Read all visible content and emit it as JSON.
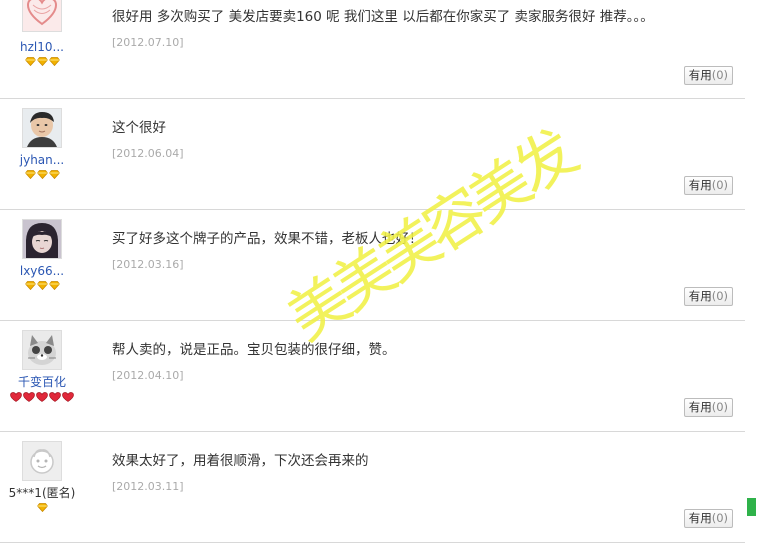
{
  "reviews": [
    {
      "username": "hzl10...",
      "rank_icon": "gold-diamond-icon",
      "rank_count": 3,
      "comment": "很好用 多次购买了 美发店要卖160 呢 我们这里 以后都在你家买了 卖家服务很好 推荐。。。",
      "date": "[2012.07.10]",
      "useful_label": "有用",
      "useful_count": "(0)",
      "avatar_icon": "heart-avatar-icon"
    },
    {
      "username": "jyhan...",
      "rank_icon": "gold-diamond-icon",
      "rank_count": 3,
      "comment": "这个很好",
      "date": "[2012.06.04]",
      "useful_label": "有用",
      "useful_count": "(0)",
      "avatar_icon": "person-photo-avatar-icon"
    },
    {
      "username": "lxy66...",
      "rank_icon": "gold-diamond-icon",
      "rank_count": 3,
      "comment": "买了好多这个牌子的产品，效果不错，老板人也好！",
      "date": "[2012.03.16]",
      "useful_label": "有用",
      "useful_count": "(0)",
      "avatar_icon": "portrait-avatar-icon"
    },
    {
      "username": "千变百化",
      "rank_icon": "red-heart-icon",
      "rank_count": 5,
      "comment": "帮人卖的，说是正品。宝贝包装的很仔细，赞。",
      "date": "[2012.04.10]",
      "useful_label": "有用",
      "useful_count": "(0)",
      "avatar_icon": "cat-avatar-icon"
    },
    {
      "username": "5***1(匿名)",
      "rank_icon": "gold-diamond-icon",
      "rank_count": 1,
      "comment": "效果太好了，用着很顺滑，下次还会再来的",
      "date": "[2012.03.11]",
      "useful_label": "有用",
      "useful_count": "(0)",
      "avatar_icon": "default-anonymous-avatar-icon"
    }
  ],
  "watermark": "美美美容美发",
  "colors": {
    "username_link": "#2b57b3",
    "date_gray": "#aaaaaa",
    "watermark_yellow": "#f1f146",
    "gold_diamond": "#f2b200",
    "red_heart": "#e0283a",
    "edge_marker_green": "#2fb24a"
  }
}
